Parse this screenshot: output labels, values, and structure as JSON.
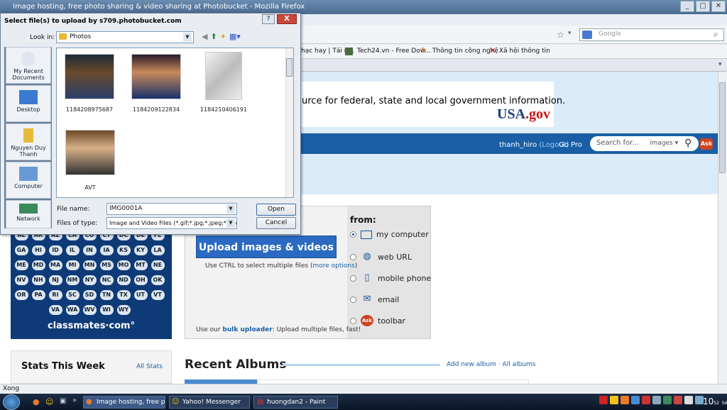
{
  "browser": {
    "title": "Image hosting, free photo sharing & video sharing at Photobucket - Mozilla Firefox",
    "search_placeholder": "Google",
    "status": "Xong",
    "bookmarks": [
      "hạc hay | Tải n...",
      "Tech24.vn - Free Dow...",
      "Thông tin công nghệ",
      "Xã hội thông tin"
    ]
  },
  "page": {
    "banner_text": "urce for federal, state and local government information.",
    "usagov": "USA",
    "usagov_dot": ".gov",
    "username": "thanh_hiro",
    "logout": "(Logout)",
    "gopro": "Go Pro",
    "search_placeholder": "Search for...",
    "search_scope": "images ▾",
    "ask": "Ask",
    "states": [
      "AL",
      "AR",
      "AZ",
      "CA",
      "CO",
      "CT",
      "DC",
      "DE",
      "FL",
      "GA",
      "HI",
      "ID",
      "IL",
      "IN",
      "IA",
      "KS",
      "KY",
      "LA",
      "ME",
      "MD",
      "MA",
      "MI",
      "MN",
      "MS",
      "MO",
      "MT",
      "NE",
      "NV",
      "NH",
      "NJ",
      "NM",
      "NY",
      "NC",
      "ND",
      "OH",
      "OK",
      "OR",
      "PA",
      "RI",
      "SC",
      "SD",
      "TN",
      "TX",
      "UT",
      "VT",
      "VA",
      "WA",
      "WV",
      "WI",
      "WY"
    ],
    "classmates": "classmates·com°",
    "upload_button": "Upload images & videos",
    "ctrl_tip": "Use CTRL to select multiple files (",
    "ctrl_tip_link": "more options",
    "ctrl_tip_end": ")",
    "bulk_prefix": "Use our ",
    "bulk_link": "bulk uploader",
    "bulk_suffix": ": Upload multiple files, fast!",
    "from_label": "from:",
    "from_options": [
      "my computer",
      "web URL",
      "mobile phone",
      "email",
      "toolbar"
    ],
    "stats_title": "Stats This Week",
    "all_stats": "All Stats",
    "recent_albums": "Recent Albums",
    "add_album": "Add new album",
    "album_sep": " · ",
    "all_albums": "All albums"
  },
  "dialog": {
    "title": "Select file(s) to upload by s709.photobucket.com",
    "help": "?",
    "close": "X",
    "look_in_label": "Look in:",
    "look_in_value": "Photos",
    "places": [
      "My Recent Documents",
      "Desktop",
      "Nguyen Duy Thanh",
      "Computer",
      "Network"
    ],
    "files": [
      "1184208975687",
      "1184209122834",
      "1184210406191",
      "AVT"
    ],
    "file_name_label": "File name:",
    "file_name_value": "IMG0001A",
    "files_of_type_label": "Files of type:",
    "files_of_type_value": "Image and Video Files (*.gif;*.jpg;*.jpeg;*.png;*.b",
    "open": "Open",
    "cancel": "Cancel"
  },
  "taskbar": {
    "buttons": [
      "Image hosting, free p...",
      "Yahoo! Messenger",
      "huongdan2 - Paint"
    ],
    "clock": "10",
    "clock_min": "52",
    "clock_ampm": "SA"
  }
}
